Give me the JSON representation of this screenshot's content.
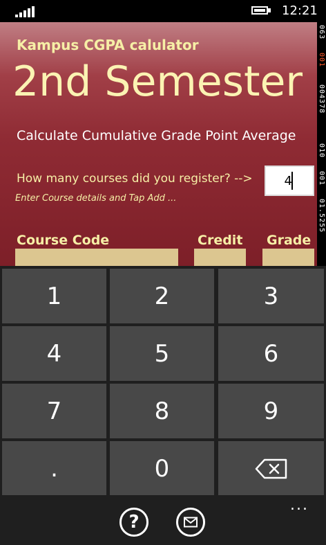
{
  "status_bar": {
    "time": "12:21",
    "icons": [
      "signal-bars-icon",
      "battery-charging-icon"
    ]
  },
  "app": {
    "title": "Kampus CGPA calulator",
    "semester_title": "2nd Semester",
    "subtitle": "Calculate Cumulative Grade Point Average",
    "courses_question": "How many courses did you register? -->",
    "courses_value": "4",
    "hint": "Enter Course details and Tap Add ...",
    "columns": {
      "course_code": "Course Code",
      "credit": "Credit",
      "grade": "Grade"
    },
    "colors": {
      "background_top": "#c07e84",
      "background_bottom": "#7d1f28",
      "title_text": "#f6efa6",
      "input_fill": "#dcc690"
    }
  },
  "side_counter": {
    "segments": [
      "063",
      "001",
      "004378",
      "010",
      "001",
      "01.5255"
    ],
    "colors": [
      "#ffffff",
      "#ff5a2a",
      "#ffffff",
      "#ffffff",
      "#ffffff",
      "#ffffff"
    ]
  },
  "keypad": {
    "keys": [
      "1",
      "2",
      "3",
      "4",
      "5",
      "6",
      "7",
      "8",
      "9",
      ".",
      "0"
    ],
    "backspace_icon": "backspace-icon",
    "key_color": "#484848"
  },
  "app_bar": {
    "help_symbol": "?",
    "more_symbol": "...",
    "icons": [
      "help-icon",
      "mail-icon",
      "more-icon"
    ]
  }
}
